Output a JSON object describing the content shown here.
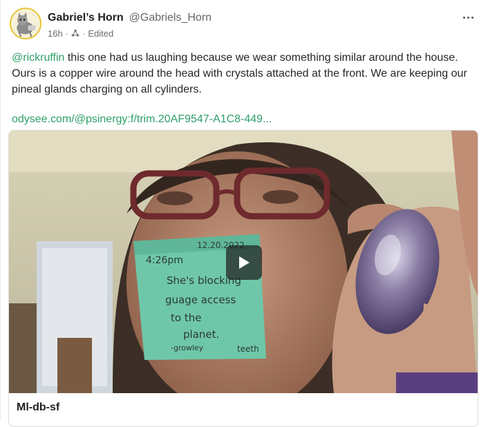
{
  "post": {
    "author_name": "Gabriel’s Horn",
    "author_handle": "@Gabriels_Horn",
    "timestamp": "16h",
    "separator": "·",
    "edited_label": "Edited",
    "source_icon": "fediverse-icon",
    "more_icon": "more-options-icon",
    "mention": "@rickruffin",
    "body": " this one had us laughing because we wear something similar around the house. Ours is a copper wire around the head with crystals attached at the front. We are keeping our pineal glands charging on all cylinders.",
    "link_text": "odysee.com/@psinergy:f/trim.20AF9547-A1C8-449...",
    "link_color": "#2e9e6a"
  },
  "media": {
    "play_icon": "play-icon",
    "title": "Ml-db-sf",
    "sticky_note_lines": [
      "4:26pm",
      "12.20.2022",
      "She's blocking",
      "guage access",
      "to the",
      "planet.",
      "-growley",
      "teeth"
    ]
  }
}
